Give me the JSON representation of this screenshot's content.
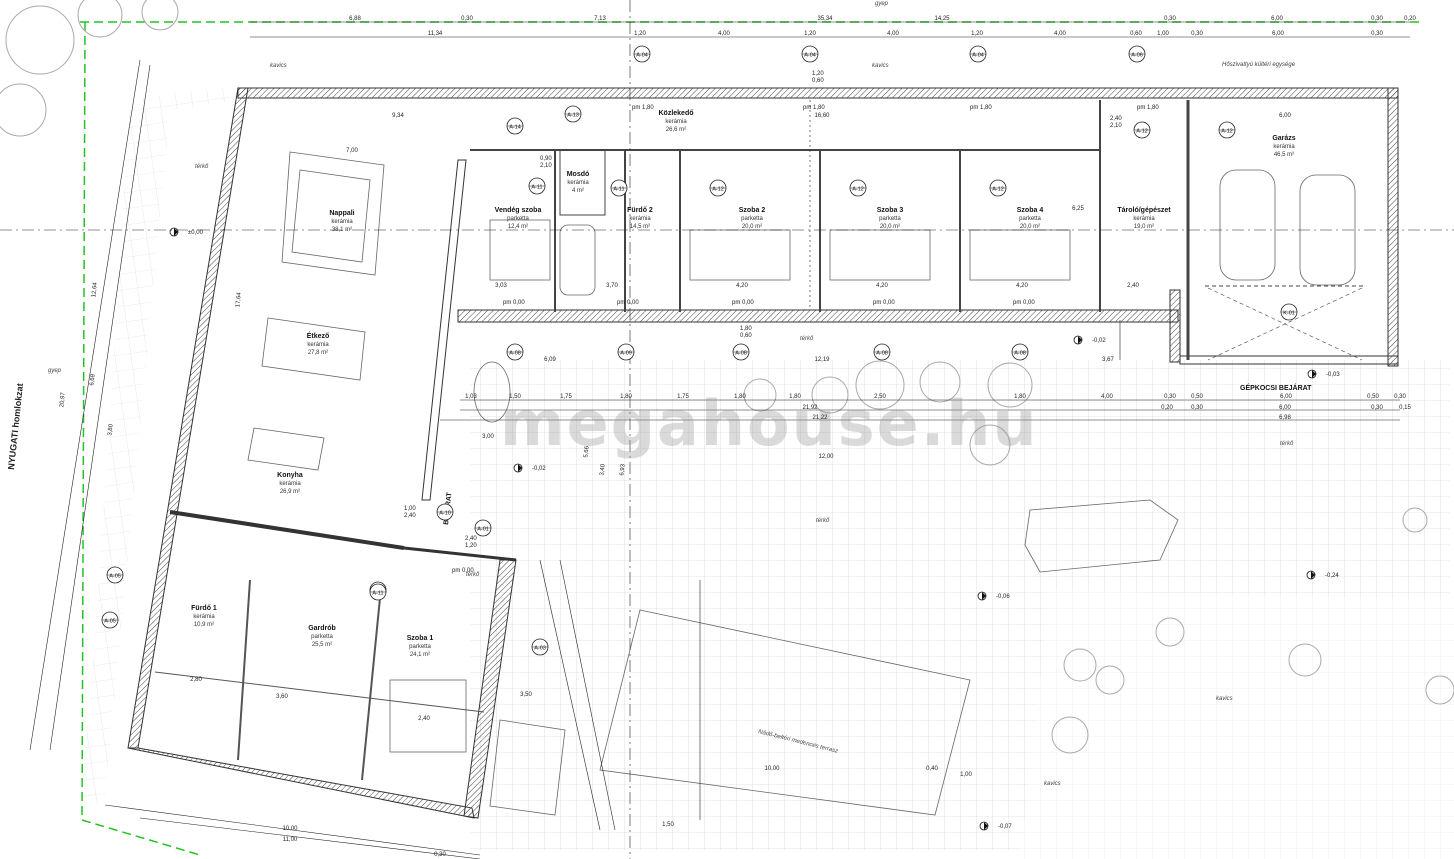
{
  "watermark": "megahouse.hu",
  "facade_label": "NYUGATI homlokzat",
  "notes": {
    "heatpump": "Hőszivattyú kültéri egysége",
    "carport_entry": "GÉPKOCSI BEJÁRAT",
    "entrance": "BEJÁRAT",
    "gravel_top": "kavics",
    "gravel_top2": "kavics",
    "gravel_right": "kavics",
    "gravel_bottom": "kavics",
    "lawn_top": "gyep",
    "lawn_left": "gyep",
    "terrace1": "térkő",
    "terrace2": "térkő",
    "terrace3": "térkő",
    "terrace4": "térkő",
    "terrace5": "térkő",
    "pool_note": "Nádő-beltéri medencés terrasz"
  },
  "rooms": [
    {
      "name": "Nappali",
      "floor": "kerámia",
      "area": "38,1 m²"
    },
    {
      "name": "Étkező",
      "floor": "kerámia",
      "area": "27,8 m²"
    },
    {
      "name": "Konyha",
      "floor": "kerámia",
      "area": "26,9 m²"
    },
    {
      "name": "Fürdő 1",
      "floor": "kerámia",
      "area": "10,9 m²"
    },
    {
      "name": "Gardrób",
      "floor": "parketta",
      "area": "25,5 m²"
    },
    {
      "name": "Szoba 1",
      "floor": "parketta",
      "area": "24,1 m²"
    },
    {
      "name": "Közlekedő",
      "floor": "kerámia",
      "area": "26,6 m²"
    },
    {
      "name": "Vendég szoba",
      "floor": "parketta",
      "area": "12,4 m²"
    },
    {
      "name": "Mosdó",
      "floor": "kerámia",
      "area": "4 m²"
    },
    {
      "name": "Fürdő 2",
      "floor": "kerámia",
      "area": "14,5 m²"
    },
    {
      "name": "Szoba 2",
      "floor": "parketta",
      "area": "20,0 m²"
    },
    {
      "name": "Szoba 3",
      "floor": "parketta",
      "area": "20,0 m²"
    },
    {
      "name": "Szoba 4",
      "floor": "parketta",
      "area": "20,0 m²"
    },
    {
      "name": "Tároló/gépészet",
      "floor": "kerámia",
      "area": "19,0 m²"
    },
    {
      "name": "Garázs",
      "floor": "kerámia",
      "area": "46,5 m²"
    }
  ],
  "window_tags": [
    "A-04",
    "A-04",
    "A-04",
    "A-06",
    "A-13",
    "A-14",
    "A-11",
    "A-11",
    "A-12",
    "A-12",
    "A-12",
    "A-12",
    "A-12",
    "A-08",
    "A-09",
    "A-08",
    "A-08",
    "A-08",
    "A-05",
    "A-05",
    "A-01",
    "A-03",
    "A-10",
    "A-10",
    "K-01",
    "A-11"
  ],
  "dims_top_row1": [
    "6,88",
    "0,30",
    "7,13",
    "35,34",
    "14,25",
    "0,30",
    "6,00",
    "0,30",
    "0,20"
  ],
  "dims_top_row2": [
    "11,34",
    "1,20",
    "4,00",
    "1,20",
    "4,00",
    "1,20",
    "4,00",
    "0,60",
    "1,00",
    "0,30",
    "6,00",
    "0,30"
  ],
  "dims_inner": [
    "9,34",
    "16,60",
    "6,00",
    "7,00",
    "6,25",
    "4,20",
    "4,20",
    "4,20",
    "3,03",
    "3,70",
    "2,40",
    "12,19",
    "3,67",
    "6,09"
  ],
  "dims_south_row": [
    "1,03",
    "1,50",
    "1,75",
    "1,80",
    "1,75",
    "1,80",
    "1,80",
    "2,50",
    "1,80",
    "4,00",
    "0,30",
    "0,50",
    "6,00",
    "0,50",
    "0,30"
  ],
  "dims_south_row2": [
    "21,92",
    "21,22",
    "0,20",
    "0,30",
    "6,00",
    "0,30",
    "0,15",
    "6,98",
    "3,00",
    "12,00"
  ],
  "dims_left": [
    "20,97",
    "12,64",
    "6,69",
    "3,80",
    "17,64",
    "5,66",
    "3,40",
    "6,93"
  ],
  "dims_bottom": [
    "10,00",
    "0,30",
    "11,00",
    "2,80",
    "3,60",
    "2,40",
    "3,50",
    "10,00",
    "0,40",
    "1,00",
    "1,50"
  ],
  "levels": [
    "pm 0,00",
    "pm 0,00",
    "pm 0,00",
    "pm 0,00",
    "pm 0,00",
    "pm 0,00",
    "pm 1,80",
    "pm 1,80",
    "pm 1,80",
    "pm 1,80",
    "-0,02",
    "-0,02",
    "-0,03",
    "-0,06",
    "-0,07",
    "-0,24",
    "±0,00"
  ],
  "window_sizes": [
    "1,20\n0,60",
    "0,90\n2,10",
    "1,80\n0,60",
    "2,40\n2,10",
    "1,00\n2,40",
    "2,40\n1,20"
  ]
}
